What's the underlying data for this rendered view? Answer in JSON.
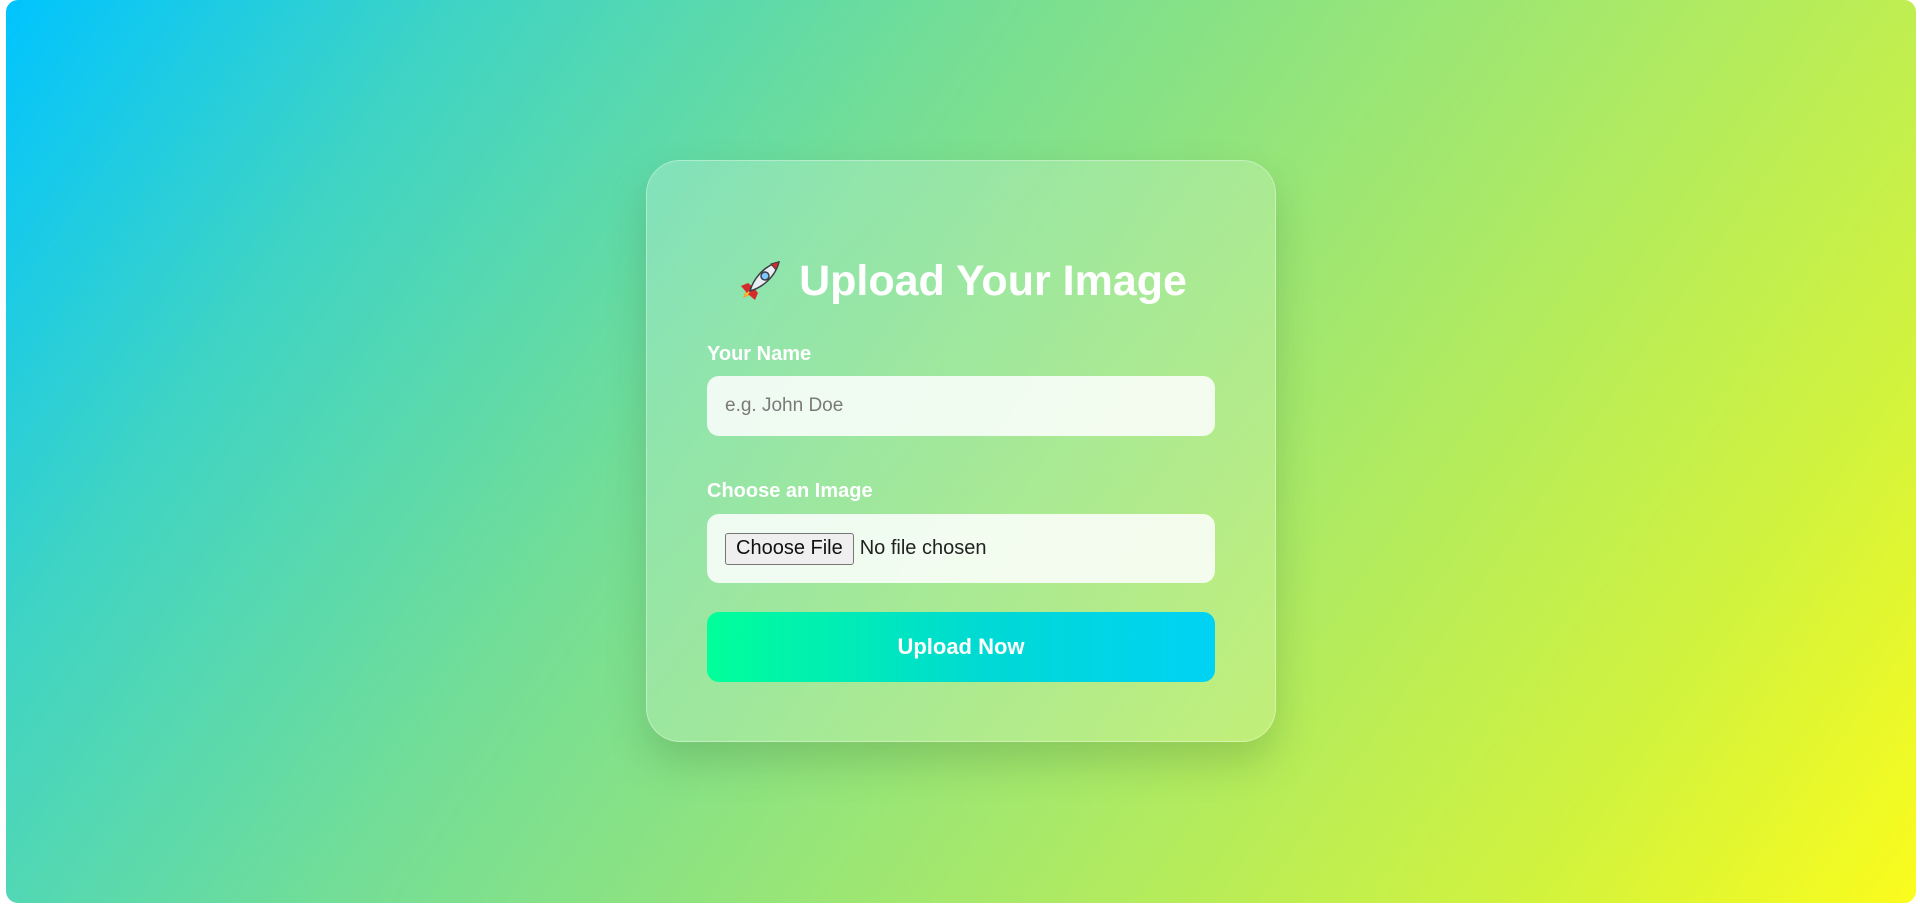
{
  "form": {
    "title_icon": "rocket-icon",
    "title": "Upload Your Image",
    "name_label": "Your Name",
    "name_placeholder": "e.g. John Doe",
    "name_value": "",
    "image_label": "Choose an Image",
    "choose_file_label": "Choose File",
    "file_status": "No file chosen",
    "submit_label": "Upload Now"
  },
  "colors": {
    "background_gradient": [
      "#00c4ff",
      "#74de96",
      "#fbfc1c"
    ],
    "button_gradient": [
      "#00ff99",
      "#00d2f5"
    ],
    "text": "#ffffff"
  }
}
